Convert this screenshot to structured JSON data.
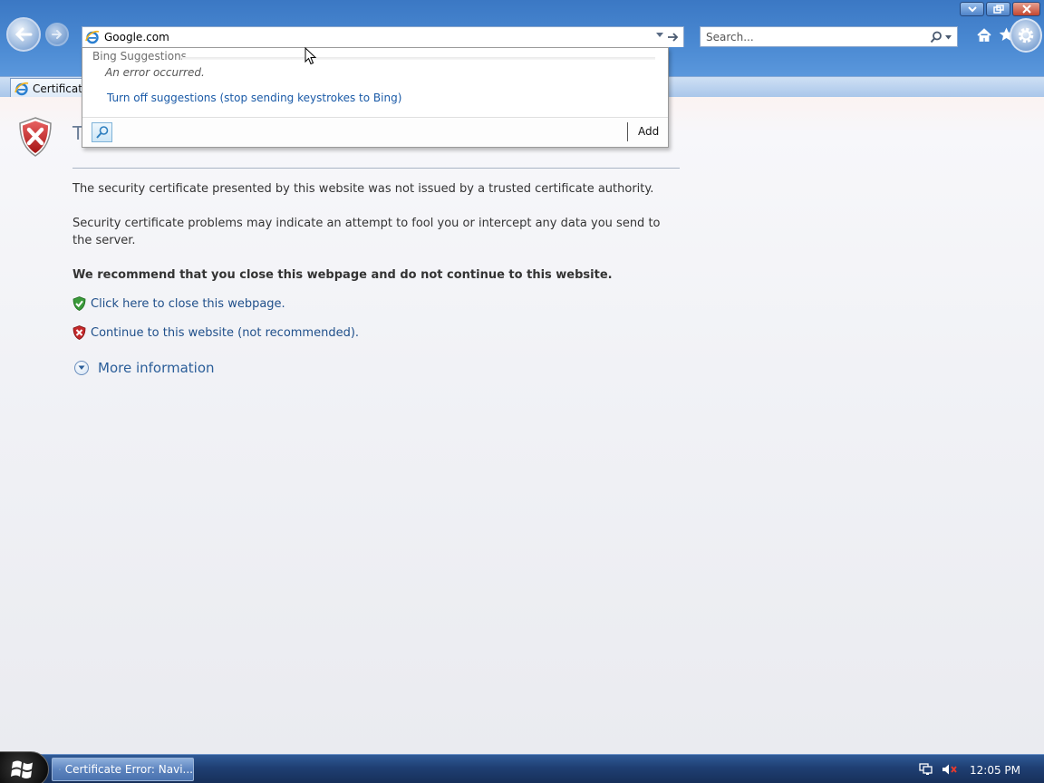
{
  "window": {
    "controls": [
      "minimize",
      "restore",
      "close"
    ]
  },
  "address_bar": {
    "value": "Google.com"
  },
  "search": {
    "placeholder": "Search..."
  },
  "tab": {
    "title": "Certificate"
  },
  "suggestions": {
    "header": "Bing Suggestions",
    "error": "An error occurred.",
    "turn_off_link": "Turn off suggestions (stop sending keystrokes to Bing)",
    "add_label": "Add"
  },
  "content": {
    "title": "T",
    "paragraph1": "The security certificate presented by this website was not issued by a trusted certificate authority.",
    "paragraph2": "Security certificate problems may indicate an attempt to fool you or intercept any data you send to the server.",
    "recommendation": "We recommend that you close this webpage and do not continue to this website.",
    "close_link": "Click here to close this webpage.",
    "continue_link": "Continue to this website (not recommended).",
    "more_info": "More information"
  },
  "taskbar": {
    "task_label": "Certificate Error: Navi...",
    "clock": "12:05 PM"
  },
  "colors": {
    "link": "#1f4f8a",
    "chrome_blue": "#4a89d2",
    "error_red": "#c4282a",
    "safe_green": "#3a9a3a"
  }
}
